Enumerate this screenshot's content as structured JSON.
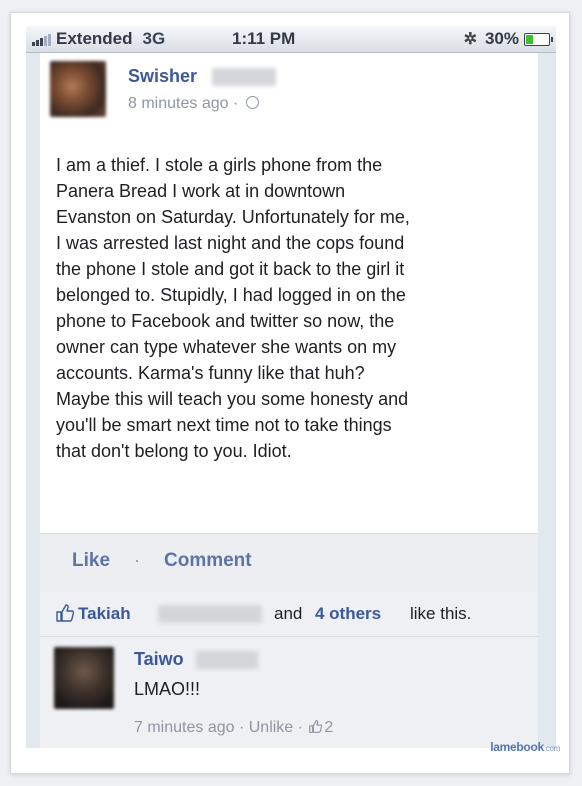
{
  "status_bar": {
    "carrier": "Extended",
    "network": "3G",
    "time": "1:11 PM",
    "battery": "30%",
    "battery_level": 0.3,
    "signal_icon": "signal-bars-icon",
    "activity_icon": "activity-spinner-icon"
  },
  "post": {
    "author": "Swisher",
    "time": "8 minutes ago ·",
    "privacy_icon": "globe-icon",
    "body_lines": [
      "I am a thief. I stole a girls phone from the",
      "Panera Bread I work at in downtown",
      "Evanston on Saturday. Unfortunately for me,",
      "I was arrested last night and the cops found",
      "the phone I stole and got it back to the girl it",
      "belonged to. Stupidly, I had logged in on the",
      "phone to Facebook and twitter so now, the",
      "owner can type whatever she wants on my",
      "accounts. Karma's funny like that huh?",
      "Maybe this will teach you some honesty and",
      "you'll be smart next time not to take things",
      "that don't belong to you. Idiot."
    ]
  },
  "actions": {
    "like": "Like",
    "separator": "·",
    "comment": "Comment"
  },
  "likes": {
    "name": "Takiah",
    "and": "and",
    "others": "4 others",
    "suffix": "like this."
  },
  "comment": {
    "author": "Taiwo",
    "text": "LMAO!!!",
    "time": "7 minutes ago ·",
    "unlike": "Unlike ·",
    "like_count": "2"
  },
  "watermark": {
    "brand": "lamebook",
    "tld": ".com"
  },
  "colors": {
    "facebook_blue": "#3b5998",
    "action_blue": "#5d74a5",
    "meta_gray": "#8f96a3"
  }
}
